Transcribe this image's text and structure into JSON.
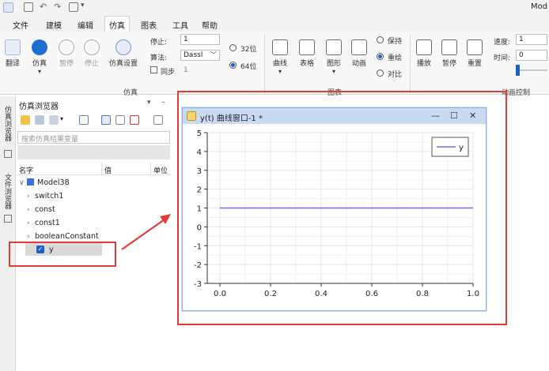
{
  "app": {
    "title_fragment": "Mod",
    "menu": [
      "文件",
      "建模",
      "编辑",
      "仿真",
      "图表",
      "工具",
      "帮助"
    ],
    "active_menu": "仿真"
  },
  "ribbon": {
    "group_sim": {
      "label": "仿真",
      "buttons": [
        "翻译",
        "仿真",
        "暂停",
        "停止",
        "仿真设置"
      ]
    },
    "params": {
      "stop_label": "停止:",
      "stop_value": "1",
      "algo_label": "算法:",
      "algo_value": "Dassl",
      "sync_label": "同步",
      "sync_value": "1",
      "bits_32": "32位",
      "bits_64": "64位"
    },
    "group_chart": {
      "label": "图表",
      "buttons": [
        "曲线",
        "表格",
        "图形",
        "动画"
      ],
      "modes": [
        "保持",
        "重绘",
        "对比"
      ]
    },
    "group_anim": {
      "label": "动画控制",
      "buttons": [
        "播放",
        "暂停",
        "重置"
      ],
      "speed_label": "速度:",
      "speed_value": "1",
      "time_label": "时间:",
      "time_value": "0"
    }
  },
  "side_tabs": [
    "仿真浏览器",
    "文件浏览器"
  ],
  "browser": {
    "title": "仿真浏览器",
    "search_placeholder": "搜索仿真结果变量",
    "columns": [
      "名字",
      "值",
      "单位"
    ],
    "tree": {
      "root": "Model38",
      "children": [
        "switch1",
        "const",
        "const1",
        "booleanConstant"
      ],
      "selected": "y"
    }
  },
  "plot_window": {
    "title": "y(t) 曲线窗口-1 *",
    "controls": [
      "—",
      "☐",
      "✕"
    ]
  },
  "chart_data": {
    "type": "line",
    "series": [
      {
        "name": "y",
        "x": [
          0.0,
          1.0
        ],
        "y": [
          1,
          1
        ],
        "color": "#6c6cf2"
      }
    ],
    "xlim": [
      -0.05,
      1.0
    ],
    "ylim": [
      -3,
      5
    ],
    "xticks": [
      0.0,
      0.2,
      0.4,
      0.6,
      0.8,
      1.0
    ],
    "yticks": [
      -3,
      -2,
      -1,
      0,
      1,
      2,
      3,
      4,
      5
    ],
    "grid": true,
    "legend_position": "top-right"
  },
  "colors": {
    "accent": "#1d5ec9",
    "highlight": "#e53935",
    "series": "#6c6cf2"
  }
}
